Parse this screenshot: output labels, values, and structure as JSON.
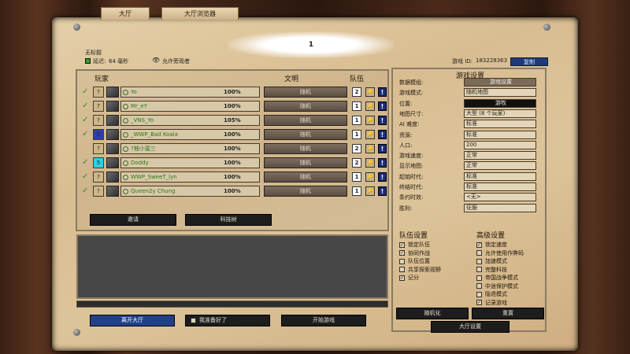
{
  "tabs": [
    "大厅",
    "大厅浏览器"
  ],
  "lobby": {
    "title": "1",
    "name": "无标题",
    "ping_label": "延迟:",
    "ping_value": "64 毫秒",
    "spectate": "允许旁观者",
    "game_id_label": "游戏 ID:",
    "game_id": "183228363",
    "copy_btn": "复制"
  },
  "players_header": {
    "player": "玩家",
    "civ": "文明",
    "team": "队伍"
  },
  "players": [
    {
      "name": "Yo",
      "pct": "100%",
      "civ": "随机",
      "team": "2",
      "checked": true,
      "slot": "?"
    },
    {
      "name": "Mr_eY",
      "pct": "100%",
      "civ": "随机",
      "team": "1",
      "checked": true,
      "slot": "?"
    },
    {
      "name": "_VNS_Yo",
      "pct": "105%",
      "civ": "随机",
      "team": "1",
      "checked": true,
      "slot": "?"
    },
    {
      "name": "_WWP_Bad Koala",
      "pct": "100%",
      "civ": "随机",
      "team": "1",
      "checked": true,
      "slot": "1"
    },
    {
      "name": "?柚小蜜三",
      "pct": "100%",
      "civ": "随机",
      "team": "2",
      "checked": false,
      "slot": "?"
    },
    {
      "name": "Doddy",
      "pct": "100%",
      "civ": "随机",
      "team": "2",
      "checked": true,
      "slot": "5"
    },
    {
      "name": "WWP_SweeT_lyn",
      "pct": "100%",
      "civ": "随机",
      "team": "1",
      "checked": true,
      "slot": "?"
    },
    {
      "name": "Queen2y Chung",
      "pct": "100%",
      "civ": "随机",
      "team": "1",
      "checked": true,
      "slot": "?"
    }
  ],
  "buttons": {
    "invite": "邀请",
    "tech_tree": "科技树",
    "leave": "离开大厅",
    "ready": "我准备好了",
    "start": "开始游戏",
    "reset": "随机化",
    "apply": "重置",
    "lobby_settings": "大厅设置"
  },
  "settings": {
    "title": "游戏设置",
    "rows": [
      {
        "label": "数据模组:",
        "value": "游戏设置"
      },
      {
        "label": "游戏模式:",
        "value": "随机地图"
      },
      {
        "label": "位置:",
        "value": "游牧"
      },
      {
        "label": "地图尺寸:",
        "value": "大型 (8 个玩家)"
      },
      {
        "label": "AI 难度:",
        "value": "标准"
      },
      {
        "label": "资源:",
        "value": "标准"
      },
      {
        "label": "人口:",
        "value": "200"
      },
      {
        "label": "游戏速度:",
        "value": "正常"
      },
      {
        "label": "显示地图:",
        "value": "正常"
      },
      {
        "label": "起始时代:",
        "value": "标准"
      },
      {
        "label": "终结时代:",
        "value": "标准"
      },
      {
        "label": "条约时效:",
        "value": "<无>"
      },
      {
        "label": "胜利:",
        "value": "征服"
      }
    ]
  },
  "team_settings": {
    "title": "队伍设置",
    "items": [
      {
        "label": "锁定队伍",
        "checked": true
      },
      {
        "label": "协同作战",
        "checked": true
      },
      {
        "label": "队伍位置",
        "checked": false
      },
      {
        "label": "共享探索视野",
        "checked": false
      },
      {
        "label": "记分",
        "checked": true
      }
    ]
  },
  "advanced_settings": {
    "title": "高级设置",
    "items": [
      {
        "label": "锁定速度",
        "checked": true
      },
      {
        "label": "允许使用作弊码",
        "checked": false
      },
      {
        "label": "加速模式",
        "checked": false
      },
      {
        "label": "完整科技",
        "checked": false
      },
      {
        "label": "帝国战争模式",
        "checked": false
      },
      {
        "label": "中途保护模式",
        "checked": false
      },
      {
        "label": "隐退模式",
        "checked": false
      },
      {
        "label": "记录游戏",
        "checked": true
      }
    ]
  }
}
